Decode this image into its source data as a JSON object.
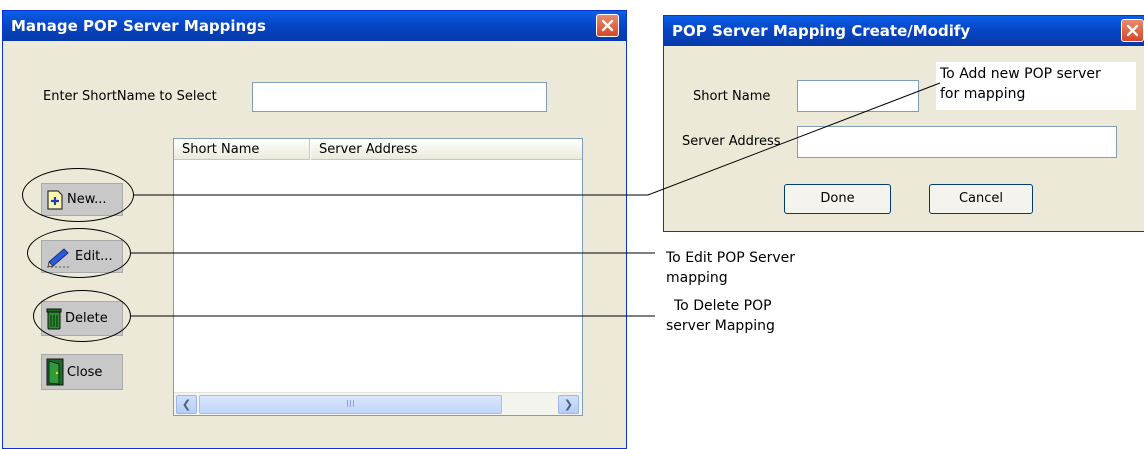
{
  "manage_window": {
    "title": "Manage POP Server Mappings",
    "select_label": "Enter ShortName to Select",
    "select_value": "",
    "columns": [
      "Short Name",
      "Server Address"
    ],
    "buttons": {
      "new": "New...",
      "edit": "Edit...",
      "delete": "Delete",
      "close": "Close"
    },
    "scroll_thumb_grip": "III"
  },
  "modify_window": {
    "title": "POP Server Mapping Create/Modify",
    "short_name_label": "Short Name",
    "short_name_value": "",
    "server_address_label": "Server Address",
    "server_address_value": "",
    "done": "Done",
    "cancel": "Cancel"
  },
  "annotations": {
    "add_line1": "To Add new POP server",
    "add_line2": "for mapping",
    "edit_line1": "To Edit POP Server",
    "edit_line2": "mapping",
    "delete_line1": "To Delete POP",
    "delete_line2": "server Mapping"
  },
  "colors": {
    "titlebar": "#0746c7",
    "window_bg": "#ece9d8",
    "close_button": "#d6462a"
  },
  "icons": {
    "new": "new-document-icon",
    "edit": "pencil-icon",
    "delete": "trash-icon",
    "close": "door-exit-icon",
    "window_close": "close-x-icon"
  }
}
